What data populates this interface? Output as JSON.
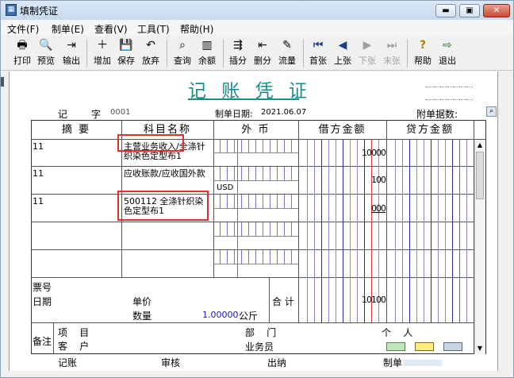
{
  "window": {
    "title": "填制凭证",
    "minimize": "▬",
    "maximize": "▣",
    "close": "✕"
  },
  "menu": [
    "文件(F)",
    "制单(E)",
    "查看(V)",
    "工具(T)",
    "帮助(H)"
  ],
  "toolbar": [
    {
      "label": "打印",
      "icon": "printer-icon",
      "glyph": "🖶"
    },
    {
      "label": "预览",
      "icon": "preview-icon",
      "glyph": "🔍"
    },
    {
      "label": "输出",
      "icon": "export-icon",
      "glyph": "⇥"
    },
    {
      "label": "增加",
      "icon": "add-icon",
      "glyph": "＋"
    },
    {
      "label": "保存",
      "icon": "save-icon",
      "glyph": "💾"
    },
    {
      "label": "放弃",
      "icon": "undo-icon",
      "glyph": "↶"
    },
    {
      "label": "查询",
      "icon": "binoculars-icon",
      "glyph": "⌕"
    },
    {
      "label": "余额",
      "icon": "balance-chart-icon",
      "glyph": "▥"
    },
    {
      "label": "插分",
      "icon": "insert-row-icon",
      "glyph": "⇶"
    },
    {
      "label": "删分",
      "icon": "delete-row-icon",
      "glyph": "⇤"
    },
    {
      "label": "流量",
      "icon": "flow-icon",
      "glyph": "✎"
    },
    {
      "label": "首张",
      "icon": "first-icon",
      "glyph": "⏮"
    },
    {
      "label": "上张",
      "icon": "prev-icon",
      "glyph": "◀"
    },
    {
      "label": "下张",
      "icon": "next-icon",
      "glyph": "▶"
    },
    {
      "label": "末张",
      "icon": "last-icon",
      "glyph": "⏭"
    },
    {
      "label": "帮助",
      "icon": "help-icon",
      "glyph": "?"
    },
    {
      "label": "退出",
      "icon": "exit-icon",
      "glyph": "⇨"
    }
  ],
  "voucher": {
    "title": "记 账 凭 证",
    "type_label": "记",
    "no_label": "字",
    "number": "0001",
    "date_label": "制单日期:",
    "date": "2021.06.07",
    "attach_label": "附单据数:",
    "headers": {
      "summary": "摘 要",
      "account": "科目名称",
      "foreign": "外 币",
      "debit": "借方金额",
      "credit": "贷方金额"
    },
    "rows": [
      {
        "summary": "11",
        "account": "主营业务收入/全涤针织染色定型布1",
        "foreign": "",
        "debit": "10000"
      },
      {
        "summary": "11",
        "account": "应收账款/应收国外款",
        "foreign": "USD",
        "debit": "100"
      },
      {
        "summary": "11",
        "account": "500112 全涤针织染色定型布1",
        "foreign": "",
        "debit": "000"
      },
      {
        "summary": "",
        "account": "",
        "foreign": "",
        "debit": ""
      },
      {
        "summary": "",
        "account": "",
        "foreign": "",
        "debit": ""
      }
    ],
    "footer": {
      "bill_no": "票号",
      "date": "日期",
      "unit_price": "单价",
      "quantity": "数量",
      "qty_value": "1.00000",
      "qty_unit": "公斤",
      "total_label": "合 计",
      "total_debit": "10100",
      "remarks": "备注",
      "project": "项    目",
      "customer": "客    户",
      "department": "部    门",
      "salesperson": "业务员",
      "person": "个    人"
    },
    "signatures": [
      "记账",
      "审核",
      "出纳",
      "制单"
    ]
  }
}
